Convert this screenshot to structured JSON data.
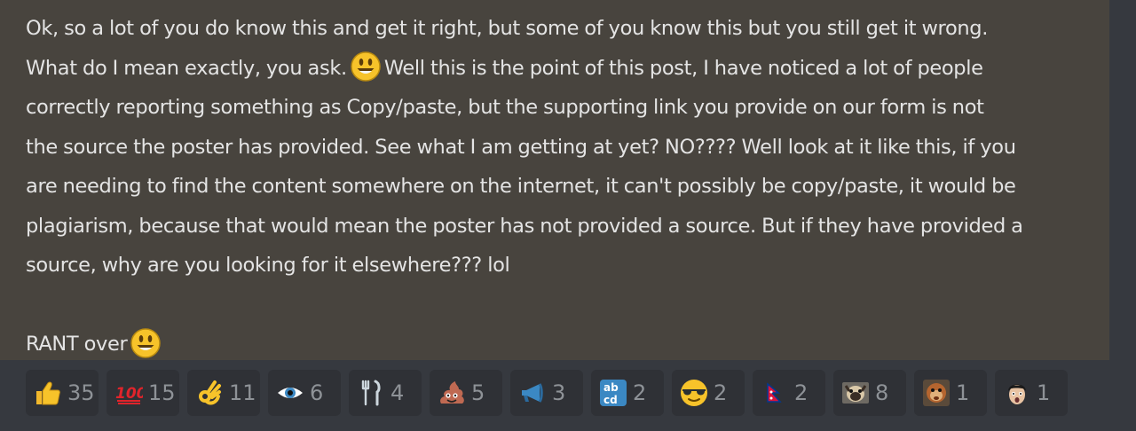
{
  "message": {
    "lines": [
      "Ok, so a lot of you do know this and get it right, but some of you know this but you still get it wrong.",
      "What do I mean exactly, you ask.",
      "Well this is the point of this post, I have noticed a lot of people",
      "correctly reporting something as Copy/paste, but the supporting link you provide on our form is not",
      "the source the poster has provided. See what I am getting at yet? NO???? Well look at it like this, if you",
      "are needing to find the content somewhere on the internet, it can't possibly be copy/paste, it would be",
      "plagiarism, because that would mean the poster has not provided a source. But if they have provided a",
      "source, why are you looking for it elsewhere??? lol",
      "",
      "RANT over"
    ]
  },
  "reactions": [
    {
      "icon": "thumbs-up-icon",
      "count": "35"
    },
    {
      "icon": "hundred-points-icon",
      "count": "15"
    },
    {
      "icon": "ok-hand-icon",
      "count": "11"
    },
    {
      "icon": "eye-icon",
      "count": "6"
    },
    {
      "icon": "fork-knife-icon",
      "count": "4"
    },
    {
      "icon": "poop-icon",
      "count": "5"
    },
    {
      "icon": "megaphone-icon",
      "count": "3"
    },
    {
      "icon": "abcd-icon",
      "count": "2"
    },
    {
      "icon": "sunglasses-face-icon",
      "count": "2"
    },
    {
      "icon": "nepal-flag-icon",
      "count": "2"
    },
    {
      "icon": "pug-emote-icon",
      "count": "8"
    },
    {
      "icon": "monkey-emote-icon",
      "count": "1"
    },
    {
      "icon": "shocked-face-emote-icon",
      "count": "1"
    }
  ],
  "colors": {
    "background": "#36393f",
    "message_highlight": "#48443e",
    "text": "#e4e4e4",
    "reaction_bg": "#2f3136",
    "reaction_count": "#8e9297"
  }
}
